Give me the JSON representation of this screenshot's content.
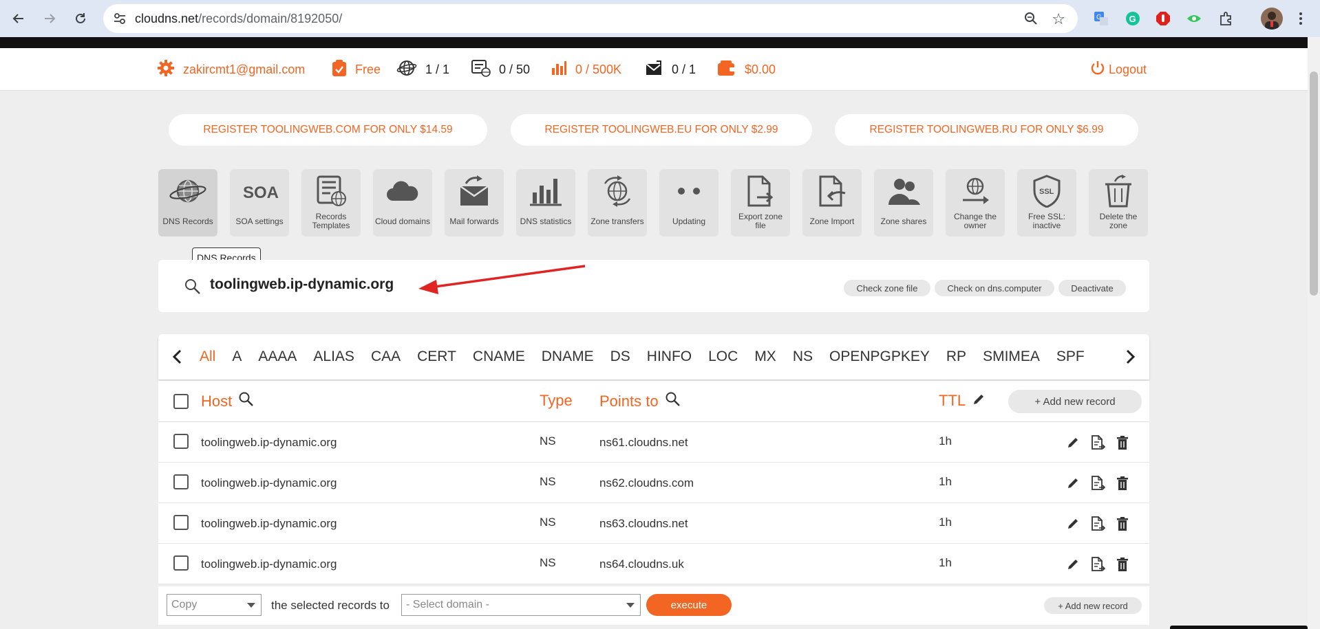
{
  "browser": {
    "url_host": "cloudns.net",
    "url_path": "/records/domain/8192050/"
  },
  "header": {
    "email": "zakircmt1@gmail.com",
    "plan": "Free",
    "domains": "1 / 1",
    "records": "0 / 50",
    "queries": "0 / 500K",
    "mail": "0 / 1",
    "balance": "$0.00",
    "logout": "Logout"
  },
  "promos": [
    "REGISTER TOOLINGWEB.COM FOR ONLY $14.59",
    "REGISTER TOOLINGWEB.EU FOR ONLY $2.99",
    "REGISTER TOOLINGWEB.RU FOR ONLY $6.99"
  ],
  "tools": [
    {
      "label": "DNS Records",
      "icon": "globe-icon"
    },
    {
      "label": "SOA settings",
      "icon": "soa-icon"
    },
    {
      "label": "Records Templates",
      "icon": "template-icon"
    },
    {
      "label": "Cloud domains",
      "icon": "cloud-icon"
    },
    {
      "label": "Mail forwards",
      "icon": "mail-forward-icon"
    },
    {
      "label": "DNS statistics",
      "icon": "bar-chart-icon"
    },
    {
      "label": "Zone transfers",
      "icon": "zone-transfer-icon"
    },
    {
      "label": "Updating",
      "icon": "dots-icon"
    },
    {
      "label": "Export zone file",
      "icon": "export-file-icon"
    },
    {
      "label": "Zone Import",
      "icon": "import-file-icon"
    },
    {
      "label": "Zone shares",
      "icon": "users-icon"
    },
    {
      "label": "Change the owner",
      "icon": "change-owner-icon"
    },
    {
      "label": "Free SSL: inactive",
      "icon": "ssl-shield-icon"
    },
    {
      "label": "Delete the zone",
      "icon": "trash-icon"
    }
  ],
  "tooltip": "DNS Records",
  "zone": {
    "name": "toolingweb.ip-dynamic.org",
    "actions": [
      "Check zone file",
      "Check on dns.computer",
      "Deactivate"
    ]
  },
  "types": [
    "All",
    "A",
    "AAAA",
    "ALIAS",
    "CAA",
    "CERT",
    "CNAME",
    "DNAME",
    "DS",
    "HINFO",
    "LOC",
    "MX",
    "NS",
    "OPENPGPKEY",
    "RP",
    "SMIMEA",
    "SPF"
  ],
  "table": {
    "headers": {
      "host": "Host",
      "type": "Type",
      "points_to": "Points to",
      "ttl": "TTL"
    },
    "add_record": "+ Add new record",
    "rows": [
      {
        "host": "toolingweb.ip-dynamic.org",
        "type": "NS",
        "points_to": "ns61.cloudns.net",
        "ttl": "1h"
      },
      {
        "host": "toolingweb.ip-dynamic.org",
        "type": "NS",
        "points_to": "ns62.cloudns.com",
        "ttl": "1h"
      },
      {
        "host": "toolingweb.ip-dynamic.org",
        "type": "NS",
        "points_to": "ns63.cloudns.net",
        "ttl": "1h"
      },
      {
        "host": "toolingweb.ip-dynamic.org",
        "type": "NS",
        "points_to": "ns64.cloudns.uk",
        "ttl": "1h"
      }
    ]
  },
  "bottom": {
    "action_select": "Copy",
    "selected_text": "the selected records to",
    "domain_select": "- Select domain -",
    "execute": "execute",
    "add_record": "+ Add new record"
  },
  "colors": {
    "accent": "#f26522",
    "arrow": "#e02424"
  }
}
